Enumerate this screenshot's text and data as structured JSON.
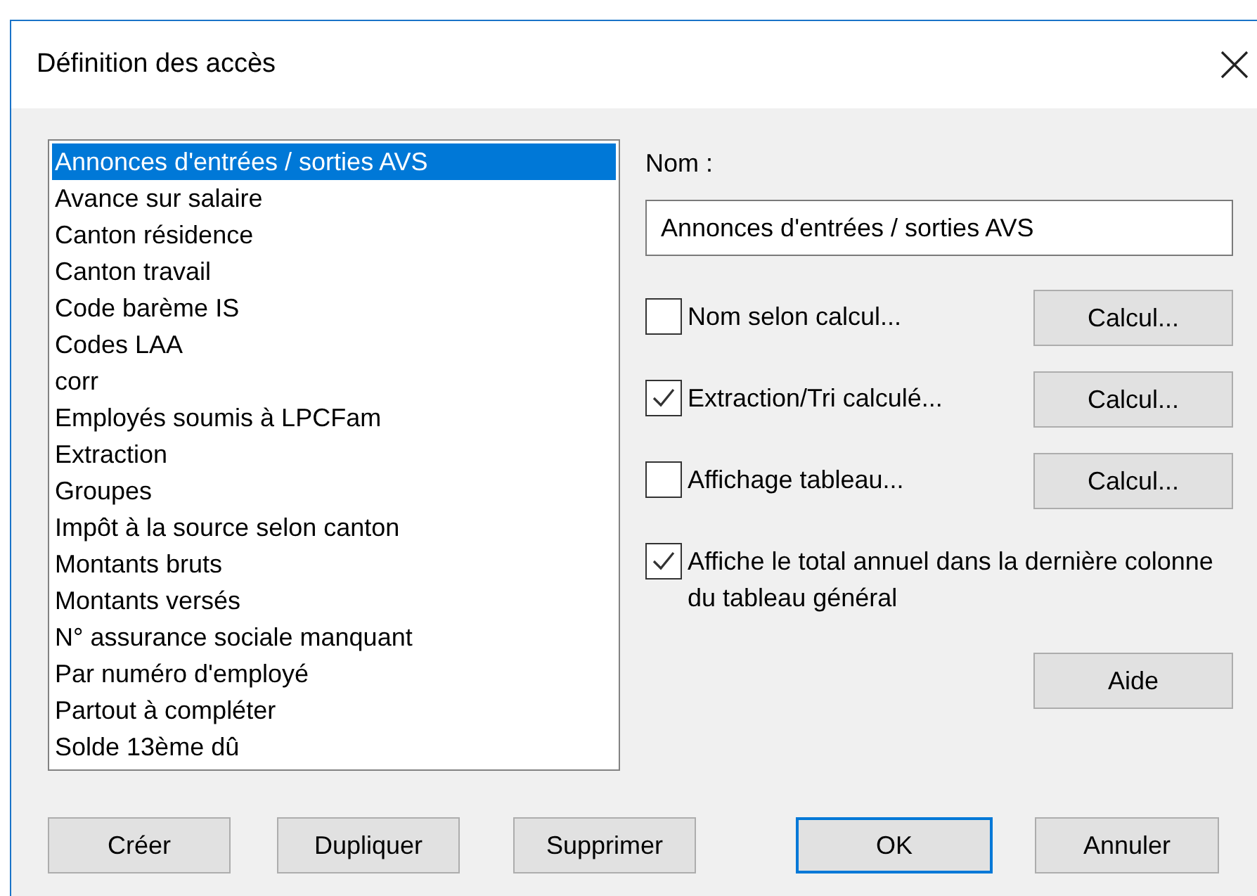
{
  "window": {
    "title": "Définition des accès"
  },
  "list": {
    "items": [
      {
        "label": "Annonces d'entrées / sorties AVS",
        "selected": true
      },
      {
        "label": "Avance sur salaire",
        "selected": false
      },
      {
        "label": "Canton résidence",
        "selected": false
      },
      {
        "label": "Canton travail",
        "selected": false
      },
      {
        "label": "Code barème IS",
        "selected": false
      },
      {
        "label": "Codes LAA",
        "selected": false
      },
      {
        "label": "corr",
        "selected": false
      },
      {
        "label": "Employés soumis à LPCFam",
        "selected": false
      },
      {
        "label": "Extraction",
        "selected": false
      },
      {
        "label": "Groupes",
        "selected": false
      },
      {
        "label": "Impôt à la source selon canton",
        "selected": false
      },
      {
        "label": "Montants bruts",
        "selected": false
      },
      {
        "label": "Montants versés",
        "selected": false
      },
      {
        "label": "N° assurance sociale manquant",
        "selected": false
      },
      {
        "label": "Par numéro d'employé",
        "selected": false
      },
      {
        "label": "Partout à compléter",
        "selected": false
      },
      {
        "label": "Solde 13ème dû",
        "selected": false
      }
    ]
  },
  "name_label": "Nom :",
  "name_field": {
    "value": "Annonces d'entrées / sorties AVS"
  },
  "options": [
    {
      "label": "Nom selon calcul...",
      "checked": false,
      "button": "Calcul..."
    },
    {
      "label": "Extraction/Tri calculé...",
      "checked": true,
      "button": "Calcul..."
    },
    {
      "label": "Affichage tableau...",
      "checked": false,
      "button": "Calcul..."
    },
    {
      "label": "Affiche le total annuel dans la dernière colonne du tableau général",
      "checked": true
    }
  ],
  "help_button": "Aide",
  "buttons": [
    {
      "label": "Créer",
      "default": false
    },
    {
      "label": "Dupliquer",
      "default": false
    },
    {
      "label": "Supprimer",
      "default": false
    },
    {
      "label": "OK",
      "default": true
    },
    {
      "label": "Annuler",
      "default": false
    }
  ]
}
